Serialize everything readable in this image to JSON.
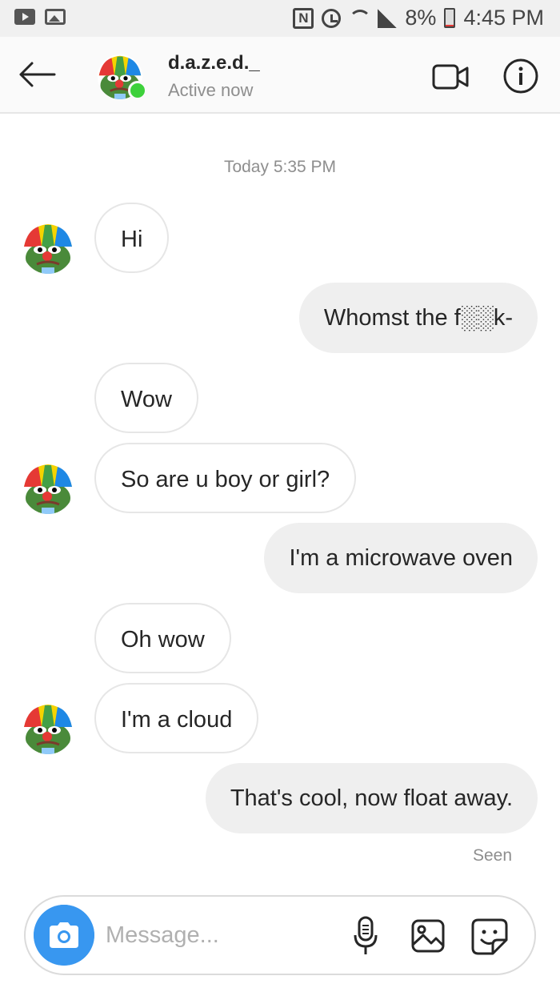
{
  "status_bar": {
    "battery": "8%",
    "time": "4:45 PM",
    "nfc": "N"
  },
  "header": {
    "username": "d.a.z.e.d._",
    "status": "Active now"
  },
  "thread": {
    "timestamp": "Today 5:35 PM",
    "messages": [
      {
        "from": "them",
        "text": "Hi"
      },
      {
        "from": "me",
        "text": "Whomst the f░░k-"
      },
      {
        "from": "them",
        "text": "Wow"
      },
      {
        "from": "them",
        "text": "So are u boy or girl?"
      },
      {
        "from": "me",
        "text": "I'm a microwave oven"
      },
      {
        "from": "them",
        "text": "Oh wow"
      },
      {
        "from": "them",
        "text": "I'm a cloud"
      },
      {
        "from": "me",
        "text": "That's cool, now float away."
      }
    ],
    "seen": "Seen"
  },
  "composer": {
    "placeholder": "Message..."
  },
  "colors": {
    "accent": "#3897f0",
    "online": "#3dd13b",
    "outgoing_bubble": "#efefef"
  },
  "icons": [
    "youtube-icon",
    "gallery-icon",
    "nfc-icon",
    "alarm-icon",
    "wifi-icon",
    "signal-icon",
    "battery-icon",
    "back-arrow-icon",
    "video-call-icon",
    "info-icon",
    "camera-icon",
    "microphone-icon",
    "image-icon",
    "sticker-icon"
  ]
}
